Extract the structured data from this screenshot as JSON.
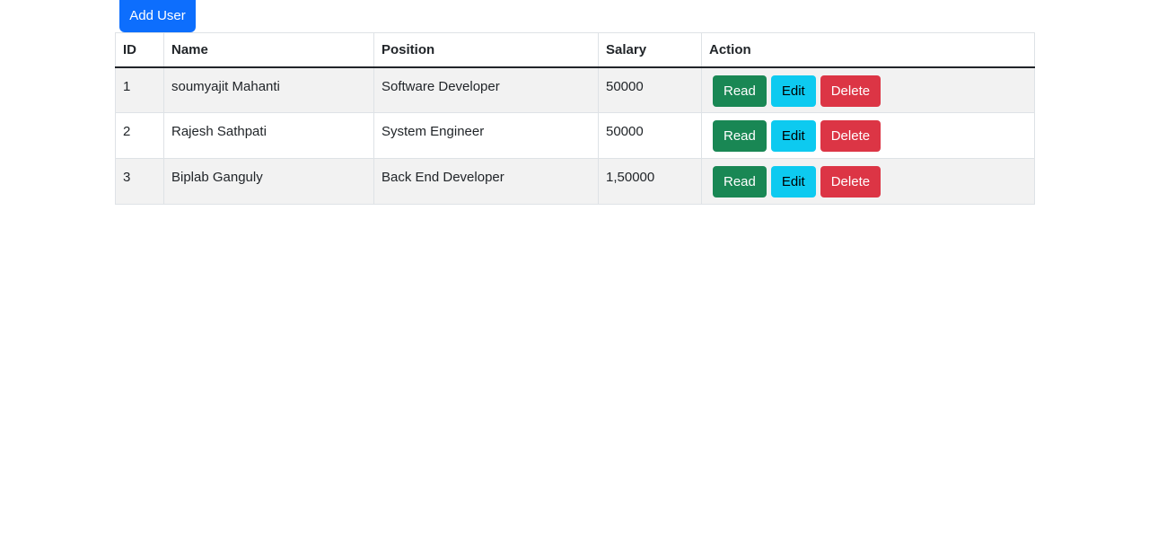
{
  "toolbar": {
    "add_user_label": "Add User"
  },
  "colors": {
    "primary": "#0d6efd",
    "success": "#198754",
    "info": "#0dcaf0",
    "danger": "#dc3545"
  },
  "table": {
    "headers": {
      "id": "ID",
      "name": "Name",
      "position": "Position",
      "salary": "Salary",
      "action": "Action"
    },
    "rows": [
      {
        "id": "1",
        "name": "soumyajit Mahanti",
        "position": "Software Developer",
        "salary": "50000"
      },
      {
        "id": "2",
        "name": "Rajesh Sathpati",
        "position": "System Engineer",
        "salary": "50000"
      },
      {
        "id": "3",
        "name": "Biplab Ganguly",
        "position": "Back End Developer",
        "salary": "1,50000"
      }
    ],
    "actions": {
      "read_label": "Read",
      "edit_label": "Edit",
      "delete_label": "Delete"
    }
  }
}
